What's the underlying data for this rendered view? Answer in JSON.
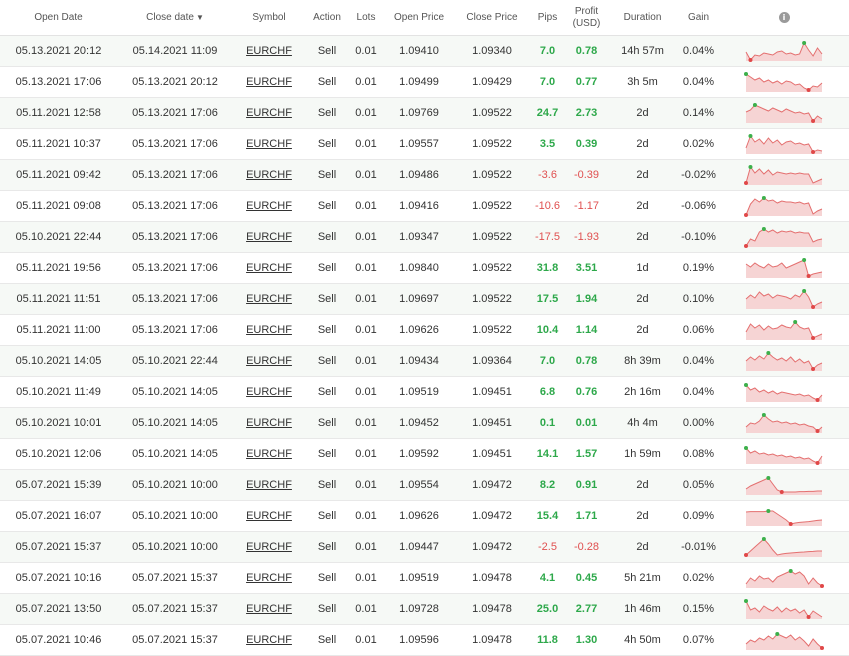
{
  "header": {
    "open_date": "Open Date",
    "close_date": "Close date",
    "sort_arrow": "▼",
    "symbol": "Symbol",
    "action": "Action",
    "lots": "Lots",
    "open_price": "Open Price",
    "close_price": "Close Price",
    "pips": "Pips",
    "profit_line1": "Profit",
    "profit_line2": "(USD)",
    "duration": "Duration",
    "gain": "Gain",
    "info_icon": "i"
  },
  "colors": {
    "positive": "#2da84a",
    "negative": "#e05050",
    "spark_line": "#e46f6f",
    "spark_fill": "#f6d4d4",
    "spark_high": "#3cb04b",
    "spark_low": "#e04848"
  },
  "rows": [
    {
      "open": "05.13.2021 20:12",
      "close": "05.14.2021 11:09",
      "symbol": "EURCHF",
      "action": "Sell",
      "lots": "0.01",
      "open_price": "1.09410",
      "close_price": "1.09340",
      "pips": "7.0",
      "profit": "0.78",
      "duration": "14h 57m",
      "gain": "0.04%",
      "spark": [
        0.45,
        0.05,
        0.3,
        0.25,
        0.4,
        0.35,
        0.3,
        0.45,
        0.5,
        0.35,
        0.4,
        0.3,
        0.35,
        0.9,
        0.55,
        0.25,
        0.65,
        0.35
      ]
    },
    {
      "open": "05.13.2021 17:06",
      "close": "05.13.2021 20:12",
      "symbol": "EURCHF",
      "action": "Sell",
      "lots": "0.01",
      "open_price": "1.09499",
      "close_price": "1.09429",
      "pips": "7.0",
      "profit": "0.77",
      "duration": "3h 5m",
      "gain": "0.04%",
      "spark": [
        0.9,
        0.75,
        0.6,
        0.7,
        0.5,
        0.6,
        0.45,
        0.55,
        0.4,
        0.55,
        0.5,
        0.35,
        0.4,
        0.2,
        0.1,
        0.3,
        0.25,
        0.45
      ]
    },
    {
      "open": "05.11.2021 12:58",
      "close": "05.13.2021 17:06",
      "symbol": "EURCHF",
      "action": "Sell",
      "lots": "0.01",
      "open_price": "1.09769",
      "close_price": "1.09522",
      "pips": "24.7",
      "profit": "2.73",
      "duration": "2d",
      "gain": "0.14%",
      "spark": [
        0.55,
        0.65,
        0.9,
        0.8,
        0.7,
        0.6,
        0.75,
        0.65,
        0.55,
        0.7,
        0.6,
        0.5,
        0.55,
        0.45,
        0.5,
        0.1,
        0.35,
        0.2
      ]
    },
    {
      "open": "05.11.2021 10:37",
      "close": "05.13.2021 17:06",
      "symbol": "EURCHF",
      "action": "Sell",
      "lots": "0.01",
      "open_price": "1.09557",
      "close_price": "1.09522",
      "pips": "3.5",
      "profit": "0.39",
      "duration": "2d",
      "gain": "0.02%",
      "spark": [
        0.3,
        0.9,
        0.6,
        0.75,
        0.5,
        0.8,
        0.55,
        0.7,
        0.45,
        0.6,
        0.65,
        0.5,
        0.55,
        0.45,
        0.5,
        0.1,
        0.2,
        0.15
      ]
    },
    {
      "open": "05.11.2021 09:42",
      "close": "05.13.2021 17:06",
      "symbol": "EURCHF",
      "action": "Sell",
      "lots": "0.01",
      "open_price": "1.09486",
      "close_price": "1.09522",
      "pips": "-3.6",
      "profit": "-0.39",
      "duration": "2d",
      "gain": "-0.02%",
      "spark": [
        0.1,
        0.9,
        0.6,
        0.8,
        0.55,
        0.75,
        0.5,
        0.65,
        0.6,
        0.55,
        0.6,
        0.55,
        0.6,
        0.55,
        0.55,
        0.1,
        0.2,
        0.3
      ]
    },
    {
      "open": "05.11.2021 09:08",
      "close": "05.13.2021 17:06",
      "symbol": "EURCHF",
      "action": "Sell",
      "lots": "0.01",
      "open_price": "1.09416",
      "close_price": "1.09522",
      "pips": "-10.6",
      "profit": "-1.17",
      "duration": "2d",
      "gain": "-0.06%",
      "spark": [
        0.05,
        0.6,
        0.85,
        0.7,
        0.9,
        0.75,
        0.8,
        0.65,
        0.75,
        0.7,
        0.7,
        0.65,
        0.7,
        0.6,
        0.65,
        0.1,
        0.25,
        0.35
      ]
    },
    {
      "open": "05.10.2021 22:44",
      "close": "05.13.2021 17:06",
      "symbol": "EURCHF",
      "action": "Sell",
      "lots": "0.01",
      "open_price": "1.09347",
      "close_price": "1.09522",
      "pips": "-17.5",
      "profit": "-1.93",
      "duration": "2d",
      "gain": "-0.10%",
      "spark": [
        0.05,
        0.4,
        0.3,
        0.75,
        0.9,
        0.75,
        0.85,
        0.7,
        0.8,
        0.75,
        0.8,
        0.7,
        0.75,
        0.7,
        0.7,
        0.25,
        0.35,
        0.4
      ]
    },
    {
      "open": "05.11.2021 19:56",
      "close": "05.13.2021 17:06",
      "symbol": "EURCHF",
      "action": "Sell",
      "lots": "0.01",
      "open_price": "1.09840",
      "close_price": "1.09522",
      "pips": "31.8",
      "profit": "3.51",
      "duration": "1d",
      "gain": "0.19%",
      "spark": [
        0.7,
        0.55,
        0.75,
        0.6,
        0.5,
        0.7,
        0.55,
        0.6,
        0.75,
        0.5,
        0.6,
        0.7,
        0.8,
        0.9,
        0.1,
        0.2,
        0.25,
        0.3
      ]
    },
    {
      "open": "05.11.2021 11:51",
      "close": "05.13.2021 17:06",
      "symbol": "EURCHF",
      "action": "Sell",
      "lots": "0.01",
      "open_price": "1.09697",
      "close_price": "1.09522",
      "pips": "17.5",
      "profit": "1.94",
      "duration": "2d",
      "gain": "0.10%",
      "spark": [
        0.5,
        0.7,
        0.55,
        0.85,
        0.65,
        0.75,
        0.55,
        0.7,
        0.65,
        0.6,
        0.5,
        0.7,
        0.6,
        0.9,
        0.6,
        0.1,
        0.25,
        0.35
      ]
    },
    {
      "open": "05.11.2021 11:00",
      "close": "05.13.2021 17:06",
      "symbol": "EURCHF",
      "action": "Sell",
      "lots": "0.01",
      "open_price": "1.09626",
      "close_price": "1.09522",
      "pips": "10.4",
      "profit": "1.14",
      "duration": "2d",
      "gain": "0.06%",
      "spark": [
        0.4,
        0.8,
        0.6,
        0.75,
        0.5,
        0.7,
        0.55,
        0.6,
        0.75,
        0.65,
        0.6,
        0.9,
        0.65,
        0.55,
        0.6,
        0.1,
        0.2,
        0.3
      ]
    },
    {
      "open": "05.10.2021 14:05",
      "close": "05.10.2021 22:44",
      "symbol": "EURCHF",
      "action": "Sell",
      "lots": "0.01",
      "open_price": "1.09434",
      "close_price": "1.09364",
      "pips": "7.0",
      "profit": "0.78",
      "duration": "8h 39m",
      "gain": "0.04%",
      "spark": [
        0.5,
        0.7,
        0.55,
        0.75,
        0.6,
        0.9,
        0.7,
        0.55,
        0.65,
        0.5,
        0.7,
        0.45,
        0.6,
        0.4,
        0.5,
        0.1,
        0.3,
        0.4
      ]
    },
    {
      "open": "05.10.2021 11:49",
      "close": "05.10.2021 14:05",
      "symbol": "EURCHF",
      "action": "Sell",
      "lots": "0.01",
      "open_price": "1.09519",
      "close_price": "1.09451",
      "pips": "6.8",
      "profit": "0.76",
      "duration": "2h 16m",
      "gain": "0.04%",
      "spark": [
        0.85,
        0.6,
        0.7,
        0.5,
        0.6,
        0.45,
        0.55,
        0.4,
        0.5,
        0.45,
        0.4,
        0.35,
        0.4,
        0.3,
        0.35,
        0.2,
        0.1,
        0.35
      ]
    },
    {
      "open": "05.10.2021 10:01",
      "close": "05.10.2021 14:05",
      "symbol": "EURCHF",
      "action": "Sell",
      "lots": "0.01",
      "open_price": "1.09452",
      "close_price": "1.09451",
      "pips": "0.1",
      "profit": "0.01",
      "duration": "4h 4m",
      "gain": "0.00%",
      "spark": [
        0.3,
        0.5,
        0.45,
        0.6,
        0.9,
        0.7,
        0.55,
        0.6,
        0.5,
        0.55,
        0.45,
        0.5,
        0.4,
        0.45,
        0.35,
        0.3,
        0.1,
        0.3
      ]
    },
    {
      "open": "05.10.2021 12:06",
      "close": "05.10.2021 14:05",
      "symbol": "EURCHF",
      "action": "Sell",
      "lots": "0.01",
      "open_price": "1.09592",
      "close_price": "1.09451",
      "pips": "14.1",
      "profit": "1.57",
      "duration": "1h 59m",
      "gain": "0.08%",
      "spark": [
        0.8,
        0.55,
        0.65,
        0.5,
        0.55,
        0.45,
        0.5,
        0.4,
        0.45,
        0.35,
        0.4,
        0.3,
        0.35,
        0.25,
        0.3,
        0.15,
        0.05,
        0.4
      ]
    },
    {
      "open": "05.07.2021 15:39",
      "close": "05.10.2021 10:00",
      "symbol": "EURCHF",
      "action": "Sell",
      "lots": "0.01",
      "open_price": "1.09554",
      "close_price": "1.09472",
      "pips": "8.2",
      "profit": "0.91",
      "duration": "2d",
      "gain": "0.05%",
      "spark": [
        0.3,
        0.45,
        0.55,
        0.65,
        0.75,
        0.85,
        0.55,
        0.25,
        0.15,
        0.15,
        0.15,
        0.15,
        0.17,
        0.17,
        0.18,
        0.18,
        0.2,
        0.2
      ]
    },
    {
      "open": "05.07.2021 16:07",
      "close": "05.10.2021 10:00",
      "symbol": "EURCHF",
      "action": "Sell",
      "lots": "0.01",
      "open_price": "1.09626",
      "close_price": "1.09472",
      "pips": "15.4",
      "profit": "1.71",
      "duration": "2d",
      "gain": "0.09%",
      "spark": [
        0.7,
        0.72,
        0.72,
        0.72,
        0.72,
        0.75,
        0.75,
        0.6,
        0.45,
        0.3,
        0.1,
        0.15,
        0.18,
        0.2,
        0.22,
        0.25,
        0.28,
        0.3
      ]
    },
    {
      "open": "05.07.2021 15:37",
      "close": "05.10.2021 10:00",
      "symbol": "EURCHF",
      "action": "Sell",
      "lots": "0.01",
      "open_price": "1.09447",
      "close_price": "1.09472",
      "pips": "-2.5",
      "profit": "-0.28",
      "duration": "2d",
      "gain": "-0.01%",
      "spark": [
        0.1,
        0.3,
        0.5,
        0.7,
        0.9,
        0.65,
        0.35,
        0.1,
        0.15,
        0.18,
        0.2,
        0.22,
        0.24,
        0.25,
        0.27,
        0.28,
        0.3,
        0.3
      ]
    },
    {
      "open": "05.07.2021 10:16",
      "close": "05.07.2021 15:37",
      "symbol": "EURCHF",
      "action": "Sell",
      "lots": "0.01",
      "open_price": "1.09519",
      "close_price": "1.09478",
      "pips": "4.1",
      "profit": "0.45",
      "duration": "5h 21m",
      "gain": "0.02%",
      "spark": [
        0.2,
        0.5,
        0.35,
        0.6,
        0.45,
        0.5,
        0.3,
        0.55,
        0.65,
        0.75,
        0.85,
        0.7,
        0.8,
        0.6,
        0.2,
        0.5,
        0.25,
        0.1
      ]
    },
    {
      "open": "05.07.2021 13:50",
      "close": "05.07.2021 15:37",
      "symbol": "EURCHF",
      "action": "Sell",
      "lots": "0.01",
      "open_price": "1.09728",
      "close_price": "1.09478",
      "pips": "25.0",
      "profit": "2.77",
      "duration": "1h 46m",
      "gain": "0.15%",
      "spark": [
        0.9,
        0.45,
        0.55,
        0.35,
        0.65,
        0.5,
        0.4,
        0.6,
        0.35,
        0.55,
        0.4,
        0.5,
        0.3,
        0.45,
        0.1,
        0.4,
        0.25,
        0.1
      ]
    },
    {
      "open": "05.07.2021 10:46",
      "close": "05.07.2021 15:37",
      "symbol": "EURCHF",
      "action": "Sell",
      "lots": "0.01",
      "open_price": "1.09596",
      "close_price": "1.09478",
      "pips": "11.8",
      "profit": "1.30",
      "duration": "4h 50m",
      "gain": "0.07%",
      "spark": [
        0.3,
        0.5,
        0.4,
        0.6,
        0.5,
        0.7,
        0.55,
        0.8,
        0.7,
        0.6,
        0.75,
        0.5,
        0.65,
        0.45,
        0.2,
        0.55,
        0.3,
        0.1
      ]
    }
  ]
}
